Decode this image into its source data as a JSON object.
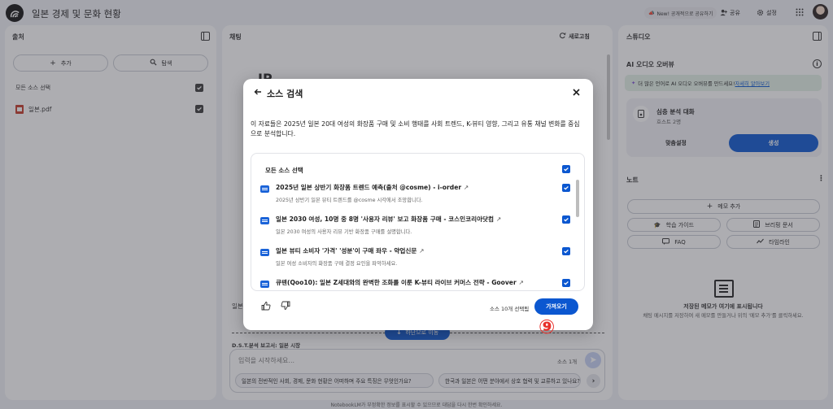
{
  "header": {
    "title": "일본 경제 및 문화 현황",
    "share_public_label": "New! 공개적으로 공유하기",
    "share_label": "공유",
    "settings_label": "설정"
  },
  "sources": {
    "title": "출처",
    "add_label": "추가",
    "explore_label": "탐색",
    "select_all_label": "모든 소스 선택",
    "items": [
      {
        "name": "일본.pdf"
      }
    ]
  },
  "chat": {
    "title": "채팅",
    "refresh_label": "새로고침",
    "bg_heading_partial": "IP",
    "bg_side_text": "일본",
    "bg_section_text": "D.S.T.분석 보고서: 일본 시장",
    "scroll_down_label": "하단으로 이동",
    "input_placeholder": "입력을 시작하세요...",
    "source_count": "소스 1개",
    "suggestions": [
      "일본의 전반적인 사회, 경제, 문화 현황은 어떠하며 주요 특징은 무엇인가요?",
      "한국과 일본은 어떤 분야에서 상호 협력 및 교류하고 있나요?"
    ],
    "footer_note": "NotebookLM가 부정확한 정보를 표시할 수 있으므로 대답을 다시 한번 확인하세요."
  },
  "studio": {
    "title": "스튜디오",
    "audio_title": "AI 오디오 오버뷰",
    "banner_text": "더 많은 언어로 AI 오디오 오버뷰를 만드세요!",
    "banner_link": "자세히 알아보기",
    "deep_dive_title": "심층 분석 대화",
    "deep_dive_sub": "호스트 2명",
    "customize_label": "맞춤설정",
    "generate_label": "생성",
    "notes_title": "노트",
    "add_note_label": "메모 추가",
    "study_guide_label": "학습 가이드",
    "briefing_label": "브리핑 문서",
    "faq_label": "FAQ",
    "timeline_label": "타임라인",
    "empty_title": "저장된 메모가 여기에 표시됩니다",
    "empty_sub": "채팅 메시지를 저장하여 새 메모를 만들거나 위의 '메모 추가'를 클릭하세요."
  },
  "modal": {
    "title": "소스 검색",
    "description": "이 자료들은 2025년 일본 20대 여성의 화장품 구매 및 소비 행태를 사회 트렌드, K-뷰티 영향, 그리고 유통 채널 변화를 중심으로 분석합니다.",
    "select_all_label": "모든 소스 선택",
    "items": [
      {
        "title": "2025년 일본 상반기 화장품 트렌드 예측(출처 @cosme) - i-order",
        "sub": "2025년 상반기 일본 뷰티 트렌드를 @cosme 시각에서 조망합니다."
      },
      {
        "title": "일본 2030 여성, 10명 중 8명 '사용자 리뷰' 보고 화장품 구매 - 코스인코리아닷컴",
        "sub": "일본 2030 여성의 사용자 리뷰 기반 화장품 구매를 설명합니다."
      },
      {
        "title": "일본 뷰티 소비자 '가격' '성분'이 구매 좌우 - 약업신문",
        "sub": "일본 여성 소비자의 화장품 구매 결정 요인을 파악하세요."
      },
      {
        "title": "큐텐(Qoo10): 일본 Z세대와의 완벽한 조화를 이룬 K-뷰티 라이브 커머스 전략 - Goover",
        "sub": ""
      }
    ],
    "selected_count": "소스 10개 선택됨",
    "import_label": "가져오기",
    "annotation": "⑨"
  },
  "colors": {
    "accent": "#0b57d0",
    "annotation": "#e8302a"
  }
}
